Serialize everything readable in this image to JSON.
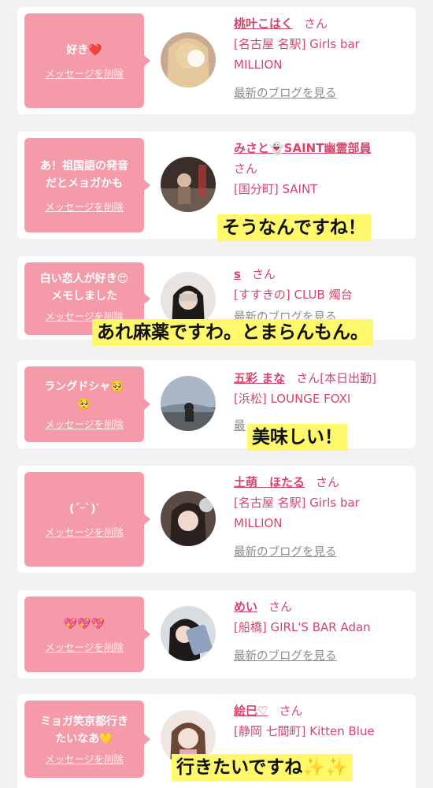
{
  "delete_label": "メッセージを削除",
  "san_label": "さん",
  "blog_label": "最新のブログを見る",
  "cards": [
    {
      "message": "好き",
      "emoji": "❤️",
      "name": "桃叶こはく",
      "shop_line1": "[名古屋 名駅] Girls bar",
      "shop_line2": "MILLION",
      "blog": "最新のブログを見る"
    },
    {
      "message": "あ！祖国語の発音\nだとメョガかも",
      "name": "みさと👻SAINT幽霊部員",
      "shop_line1": "[国分町] SAINT"
    },
    {
      "message": "白い恋人が好き😍\nメモしました",
      "name": "s",
      "shop_line1": "[すすきの] CLUB 燭台"
    },
    {
      "message": "ラングドシャ🥺\n🥺",
      "name": "五彩 まな",
      "extra": "[本日出勤]",
      "shop_line1": "[浜松] LOUNGE FOXI"
    },
    {
      "message": "(ˊᵕˋ)ᐝ",
      "name": "土萌　ほたる",
      "shop_line1": "[名古屋 名駅] Girls bar",
      "shop_line2": "MILLION",
      "blog": "最新のブログを見る"
    },
    {
      "message": "💖💖💖",
      "name": "めい",
      "shop_line1": "[船橋] GIRL'S BAR Adan",
      "blog": "最新のブログを見る"
    },
    {
      "message": "ミョガ笑京都行き\nたいなあ💛",
      "name": "絵巳♡",
      "shop_line1": "[静岡 七間町] Kitten Blue"
    }
  ],
  "captions": {
    "c1": "そうなんですね！",
    "c2": "あれ麻薬ですわ。とまらんもん。",
    "c3": "美味しい！",
    "c4": "行きたいですね✨✨"
  },
  "partial_texts": {
    "blog_partial_3": "最新のブログを見る",
    "blog_partial_4": "最"
  },
  "colors": {
    "bubble": "#f59aa8",
    "name": "#d6456a",
    "caption_bg": "#fff86a"
  }
}
